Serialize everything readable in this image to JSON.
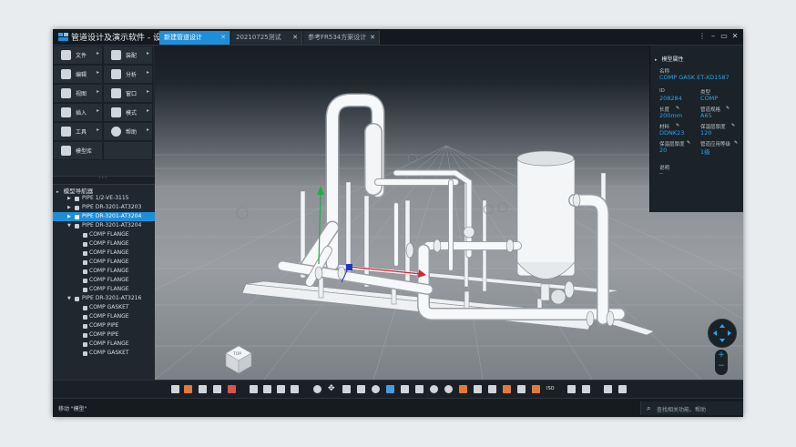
{
  "app": {
    "title": "管道设计及演示软件 - 设计",
    "tabs": [
      {
        "label": "新建管道设计",
        "active": true
      },
      {
        "label": "20210725测试",
        "active": false
      },
      {
        "label": "参考FR534方案设计",
        "active": false
      }
    ],
    "window_buttons": [
      "⋮",
      "–",
      "▭",
      "✕"
    ]
  },
  "menu": [
    {
      "label": "文件",
      "icon": "file-icon"
    },
    {
      "label": "装配",
      "icon": "assembly-icon"
    },
    {
      "label": "编辑",
      "icon": "edit-icon"
    },
    {
      "label": "分析",
      "icon": "analysis-icon"
    },
    {
      "label": "视图",
      "icon": "view-icon"
    },
    {
      "label": "窗口",
      "icon": "window-icon"
    },
    {
      "label": "插入",
      "icon": "insert-icon"
    },
    {
      "label": "模式",
      "icon": "mode-icon"
    },
    {
      "label": "工具",
      "icon": "tools-icon"
    },
    {
      "label": "帮助",
      "icon": "help-icon"
    },
    {
      "label": "模型库",
      "icon": "model-library-icon"
    }
  ],
  "navigator": {
    "title": "模型导航器",
    "items": [
      {
        "label": "PIPE 1/2-VE-3115",
        "level": 1,
        "expanded": false,
        "selected": false
      },
      {
        "label": "PIPE DR-3201-AT3203",
        "level": 1,
        "expanded": false,
        "selected": false
      },
      {
        "label": "PIPE DR-3201-AT3204",
        "level": 1,
        "expanded": false,
        "selected": true
      },
      {
        "label": "PIPE DR-3201-AT3204",
        "level": 1,
        "expanded": true,
        "selected": false
      },
      {
        "label": "COMP FLANGE",
        "level": 2
      },
      {
        "label": "COMP FLANGE",
        "level": 2
      },
      {
        "label": "COMP FLANGE",
        "level": 2
      },
      {
        "label": "COMP FLANGE",
        "level": 2
      },
      {
        "label": "COMP FLANGE",
        "level": 2
      },
      {
        "label": "COMP FLANGE",
        "level": 2
      },
      {
        "label": "COMP FLANGE",
        "level": 2
      },
      {
        "label": "PIPE DR-3201-AT3216",
        "level": 1,
        "expanded": true,
        "selected": false
      },
      {
        "label": "COMP GASKET",
        "level": 2
      },
      {
        "label": "COMP FLANGE",
        "level": 2
      },
      {
        "label": "COMP PIPE",
        "level": 2
      },
      {
        "label": "COMP PIPE",
        "level": 2
      },
      {
        "label": "COMP FLANGE",
        "level": 2
      },
      {
        "label": "COMP GASKET",
        "level": 2
      }
    ]
  },
  "properties": {
    "title": "模型属性",
    "name_label": "名称",
    "name_value": "COMP GASK ET-XD1587",
    "fields": [
      {
        "label": "ID",
        "value": "208284",
        "editable": false
      },
      {
        "label": "类型",
        "value": "COMP",
        "editable": false
      },
      {
        "label": "长度",
        "value": "200mm",
        "editable": true
      },
      {
        "label": "管道规格",
        "value": "A65",
        "editable": true
      },
      {
        "label": "材料",
        "value": "DDNK23",
        "editable": true
      },
      {
        "label": "保温层厚度",
        "value": "120",
        "editable": true
      },
      {
        "label": "保温层厚度",
        "value": "20",
        "editable": true
      },
      {
        "label": "管道应用等级",
        "value": "1级",
        "editable": true
      }
    ],
    "desc_label": "说明",
    "desc_value": "--"
  },
  "viewcube": {
    "label": "TOP"
  },
  "navigation": {
    "zoom_in": "+",
    "zoom_out": "−"
  },
  "toolbar_icons": [
    "new-icon",
    "open-icon",
    "save-icon",
    "print-icon",
    "export-icon",
    "import-icon",
    "measure-icon",
    "section-icon",
    "copy-icon",
    "zoom-icon",
    "pan-icon",
    "fit-icon",
    "window-zoom-icon",
    "zoom-out-icon",
    "front-view-icon",
    "side-view-icon",
    "top-view-icon",
    "rotate-icon",
    "orbit-icon",
    "shade-icon",
    "wireframe-icon",
    "hidden-line-icon",
    "edges-icon",
    "texture-icon",
    "material-icon",
    "light-icon",
    "iso-view-icon",
    "grid-icon",
    "layer-icon",
    "filter-icon",
    "settings-icon"
  ],
  "toolbar_iso_label": "ISO",
  "status": {
    "text": "移动 \"模型\"",
    "search_placeholder": "查找相关功能、帮助"
  },
  "colors": {
    "accent": "#1e8ed8",
    "value_text": "#2aa6f0",
    "panel_bg": "#1b2228"
  }
}
